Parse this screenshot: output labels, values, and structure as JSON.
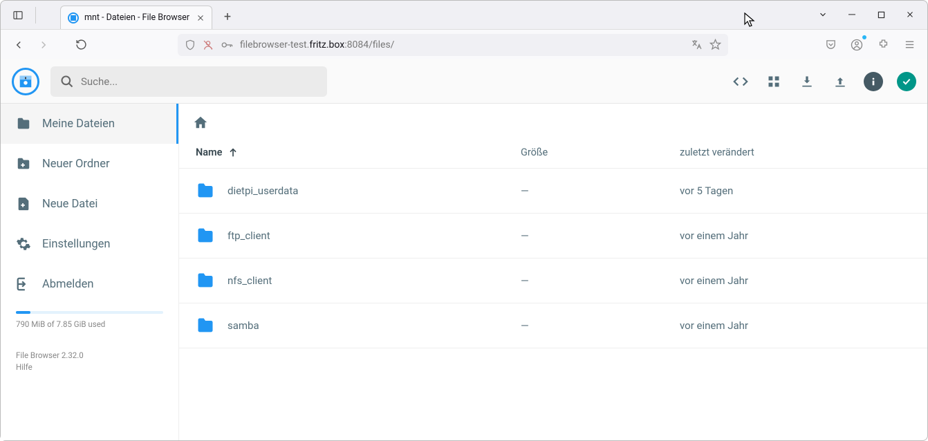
{
  "browser": {
    "tab_title": "mnt - Dateien - File Browser",
    "url_prefix": "filebrowser-test.",
    "url_host": "fritz.box",
    "url_suffix": ":8084/files/"
  },
  "header": {
    "search_placeholder": "Suche..."
  },
  "sidebar": {
    "items": [
      {
        "label": "Meine Dateien"
      },
      {
        "label": "Neuer Ordner"
      },
      {
        "label": "Neue Datei"
      },
      {
        "label": "Einstellungen"
      },
      {
        "label": "Abmelden"
      }
    ],
    "storage_text": "790 MiB of 7.85 GiB used",
    "version": "File Browser 2.32.0",
    "help": "Hilfe"
  },
  "list": {
    "col_name": "Name",
    "col_size": "Größe",
    "col_modified": "zuletzt verändert",
    "rows": [
      {
        "name": "dietpi_userdata",
        "size": "—",
        "modified": "vor 5 Tagen"
      },
      {
        "name": "ftp_client",
        "size": "—",
        "modified": "vor einem Jahr"
      },
      {
        "name": "nfs_client",
        "size": "—",
        "modified": "vor einem Jahr"
      },
      {
        "name": "samba",
        "size": "—",
        "modified": "vor einem Jahr"
      }
    ]
  }
}
